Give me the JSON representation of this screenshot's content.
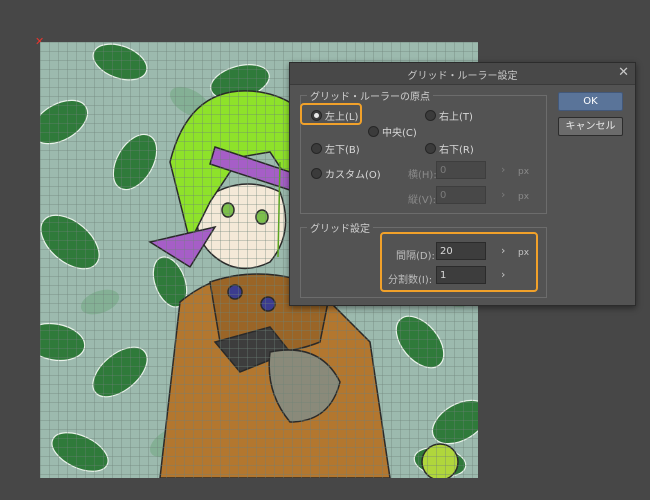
{
  "canvas": {
    "close_mark": "✕"
  },
  "dialog": {
    "title": "グリッド・ルーラー設定",
    "close_label": "✕",
    "origin_group": {
      "legend": "グリッド・ルーラーの原点",
      "options": {
        "top_left": "左上(L)",
        "top_right": "右上(T)",
        "center": "中央(C)",
        "bottom_left": "左下(B)",
        "bottom_right": "右下(R)",
        "custom": "カスタム(O)"
      },
      "selected": "top_left",
      "horizontal_label": "横(H):",
      "horizontal_value": "0",
      "vertical_label": "縦(V):",
      "vertical_value": "0",
      "unit": "px"
    },
    "grid_group": {
      "legend": "グリッド設定",
      "interval_label": "間隔(D):",
      "interval_value": "20",
      "interval_unit": "px",
      "divisions_label": "分割数(I):",
      "divisions_value": "1"
    },
    "ok_label": "OK",
    "cancel_label": "キャンセル"
  },
  "icons": {
    "chevron": "›"
  },
  "colors": {
    "highlight": "#f1a12a",
    "ok_button": "#5a7499",
    "dialog_bg": "#535353",
    "canvas_bg": "#9cbaae"
  }
}
